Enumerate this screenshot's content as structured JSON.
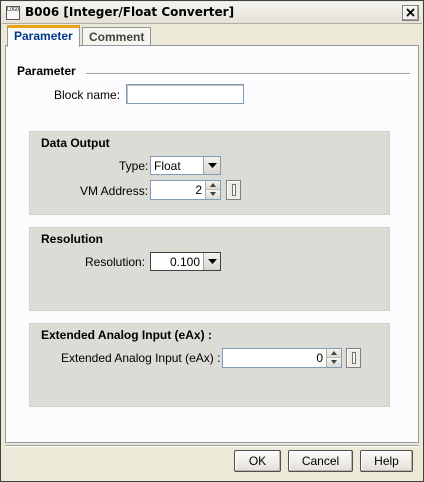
{
  "window": {
    "icon_text": "LOGO",
    "title": "B006 [Integer/Float Converter]"
  },
  "tabs": [
    {
      "label": "Parameter",
      "active": true
    },
    {
      "label": "Comment",
      "active": false
    }
  ],
  "parameter": {
    "section_title": "Parameter",
    "block_name_label": "Block name:",
    "block_name_value": ""
  },
  "data_output": {
    "title": "Data Output",
    "type_label": "Type:",
    "type_value": "Float",
    "vm_label": "VM Address:",
    "vm_value": "2"
  },
  "resolution": {
    "title": "Resolution",
    "label": "Resolution:",
    "value": "0.100"
  },
  "extended": {
    "title": "Extended Analog Input (eAx) :",
    "label": "Extended Analog Input (eAx) :",
    "value": "0"
  },
  "buttons": {
    "ok": "OK",
    "cancel": "Cancel",
    "help": "Help"
  },
  "colors": {
    "active_tab_text": "#00398c",
    "active_tab_accent": "#e8a317"
  }
}
